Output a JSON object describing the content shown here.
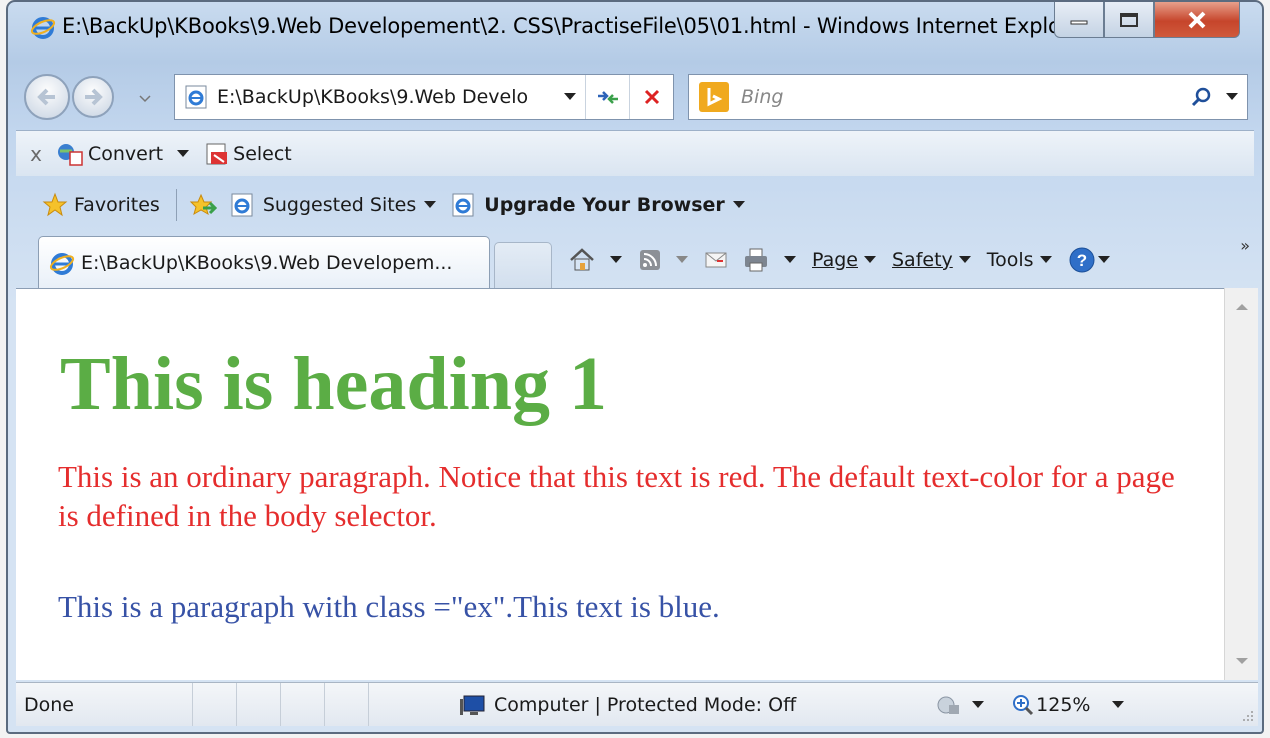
{
  "window": {
    "title": "E:\\BackUp\\KBooks\\9.Web Developement\\2. CSS\\PractiseFile\\05\\01.html - Windows Internet Explo..."
  },
  "nav": {
    "address": "E:\\BackUp\\KBooks\\9.Web Develo",
    "search_placeholder": "Bing"
  },
  "convert_toolbar": {
    "convert_label": "Convert",
    "select_label": "Select"
  },
  "favorites_bar": {
    "favorites_label": "Favorites",
    "suggested_sites_label": "Suggested Sites",
    "upgrade_label": "Upgrade Your Browser"
  },
  "tabs": {
    "active_label": "E:\\BackUp\\KBooks\\9.Web Developem..."
  },
  "command_bar": {
    "page_label": "Page",
    "safety_label": "Safety",
    "tools_label": "Tools"
  },
  "page": {
    "heading": "This is heading 1",
    "paragraph": "This is an ordinary paragraph. Notice that this text is red. The default text-color for a page is defined in the body selector.",
    "paragraph_ex": "This is a paragraph with class =\"ex\".This text is blue.",
    "colors": {
      "heading": "#5bad45",
      "paragraph": "#e52d2d",
      "paragraph_ex": "#3752a6"
    }
  },
  "status": {
    "text": "Done",
    "zone": "Computer | Protected Mode: Off",
    "zoom": "125%"
  }
}
